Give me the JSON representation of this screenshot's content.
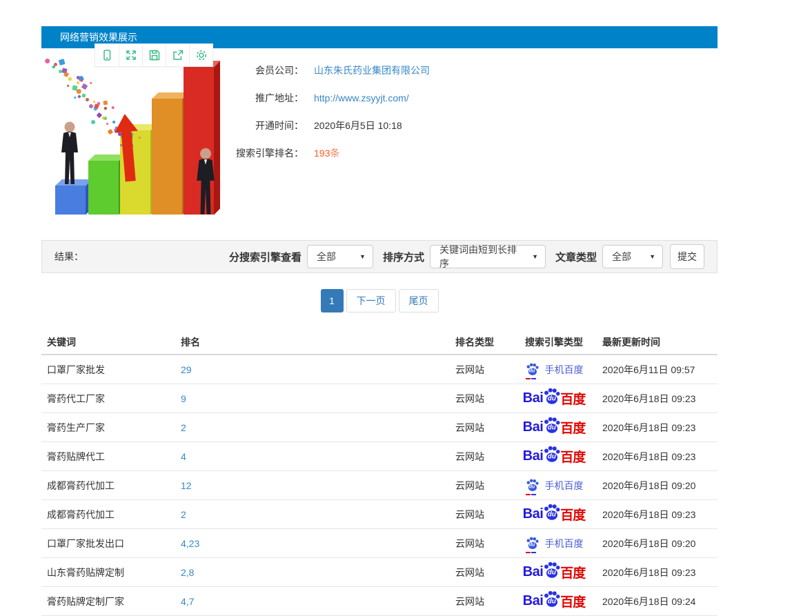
{
  "header": {
    "title": "网络营销效果展示"
  },
  "toolbar": {
    "icons": [
      "mobile-preview",
      "fullscreen",
      "save",
      "share",
      "settings"
    ]
  },
  "info": {
    "fields": [
      {
        "label": "会员公司：",
        "value": "山东朱氏药业集团有限公司"
      },
      {
        "label": "推广地址：",
        "value": "http://www.zsyyjt.com/"
      },
      {
        "label": "开通时间：",
        "value": "2020年6月5日 10:18"
      },
      {
        "label": "搜索引擎排名：",
        "value": "193",
        "unit": "条"
      }
    ]
  },
  "filters": {
    "result_label": "结果：",
    "engine_label": "分搜索引擎查看",
    "engine_value": "全部",
    "sort_label": "排序方式",
    "sort_value": "关键词由短到长排序",
    "article_label": "文章类型",
    "article_value": "全部",
    "submit_label": "提交",
    "caret": "▼"
  },
  "pagination": {
    "current": "1",
    "next_label": "下一页",
    "last_label": "尾页"
  },
  "branding": {
    "baidu_bai": "Bai",
    "baidu_du": "du",
    "baidu_cn": "百度",
    "mobile_baidu": "手机百度"
  },
  "table": {
    "headers": [
      "关键词",
      "排名",
      "排名类型",
      "搜索引擎类型",
      "最新更新时间"
    ],
    "rows": [
      {
        "keyword": "口罩厂家批发",
        "rank": "29",
        "rank_type": "云网站",
        "engine": "mobile-baidu",
        "updated": "2020年6月11日 09:57"
      },
      {
        "keyword": "膏药代工厂家",
        "rank": "9",
        "rank_type": "云网站",
        "engine": "baidu-pc",
        "updated": "2020年6月18日 09:23"
      },
      {
        "keyword": "膏药生产厂家",
        "rank": "2",
        "rank_type": "云网站",
        "engine": "baidu-pc",
        "updated": "2020年6月18日 09:23"
      },
      {
        "keyword": "膏药贴牌代工",
        "rank": "4",
        "rank_type": "云网站",
        "engine": "baidu-pc",
        "updated": "2020年6月18日 09:23"
      },
      {
        "keyword": "成都膏药代加工",
        "rank": "12",
        "rank_type": "云网站",
        "engine": "mobile-baidu",
        "updated": "2020年6月18日 09:20"
      },
      {
        "keyword": "成都膏药代加工",
        "rank": "2",
        "rank_type": "云网站",
        "engine": "baidu-pc",
        "updated": "2020年6月18日 09:23"
      },
      {
        "keyword": "口罩厂家批发出口",
        "rank": "4,23",
        "rank_type": "云网站",
        "engine": "mobile-baidu",
        "updated": "2020年6月18日 09:20"
      },
      {
        "keyword": "山东膏药贴牌定制",
        "rank": "2,8",
        "rank_type": "云网站",
        "engine": "baidu-pc",
        "updated": "2020年6月18日 09:23"
      },
      {
        "keyword": "膏药贴牌定制厂家",
        "rank": "4,7",
        "rank_type": "云网站",
        "engine": "baidu-pc",
        "updated": "2020年6月18日 09:24"
      }
    ]
  },
  "colors": {
    "header_blue": "#0082c8",
    "link_blue": "#3687c8",
    "accent_orange": "#ff5a1e",
    "icon_green": "#3bbd85",
    "baidu_blue": "#2319dc",
    "baidu_red": "#e10602",
    "pagination_blue": "#337ab7"
  }
}
